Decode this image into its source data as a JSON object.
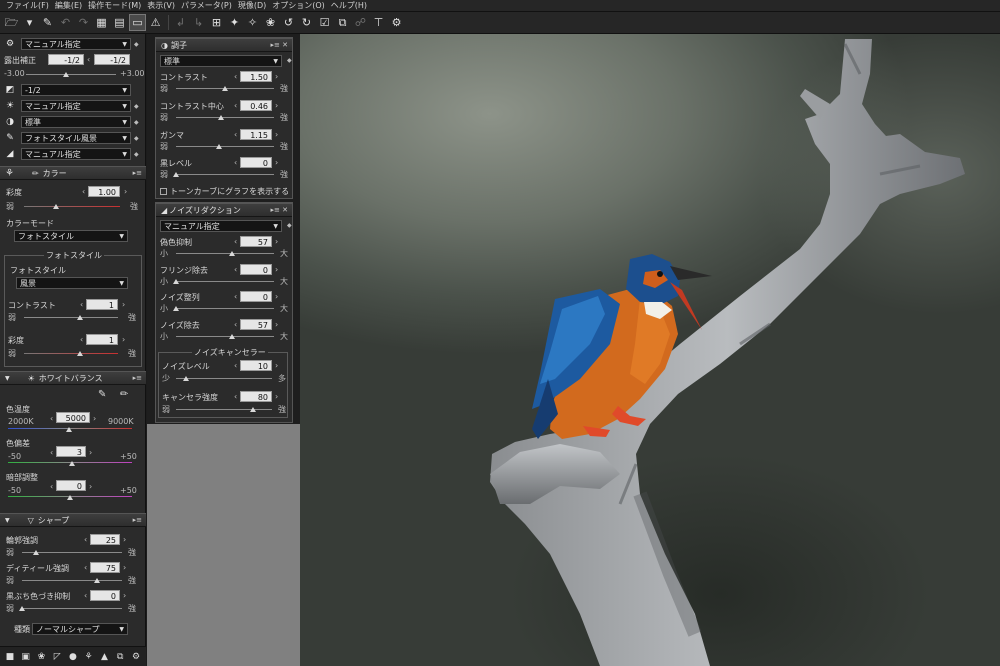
{
  "menu": [
    "ファイル(F)",
    "編集(E)",
    "操作モード(M)",
    "表示(V)",
    "パラメータ(P)",
    "現像(D)",
    "オプション(O)",
    "ヘルプ(H)"
  ],
  "toolbar_icons": [
    "open-icon",
    "open-folder-icon",
    "eyedropper-icon",
    "undo-icon",
    "redo-icon",
    "grid-view-icon",
    "filmstrip-view-icon",
    "single-view-icon",
    "warning-icon",
    "rotate-left-icon",
    "rotate-right-icon",
    "crop-icon",
    "magic-wand-icon",
    "dust-icon",
    "spot-icon",
    "tone-icon",
    "flip-icon",
    "rotate-icon",
    "check-icon",
    "compare-icon",
    "transfer-icon",
    "text-icon",
    "stamp-icon"
  ],
  "left": {
    "preset": "マニュアル指定",
    "exposure": {
      "label": "露出補正",
      "value1": "-1/2",
      "value2": "-1/2",
      "min": "-3.00",
      "max": "+3.00",
      "pos": 0.44
    },
    "rows": [
      {
        "value": "-1/2"
      },
      {
        "value": "マニュアル指定"
      },
      {
        "value": "標準"
      },
      {
        "value": "フォトスタイル風景"
      },
      {
        "value": "マニュアル指定"
      }
    ],
    "color": {
      "title": "カラー",
      "saturation": {
        "label": "彩度",
        "value": "1.00",
        "left": "弱",
        "right": "強",
        "pos": 0.33
      },
      "mode_label": "カラーモード",
      "mode_value": "フォトスタイル",
      "fieldset": "フォトスタイル",
      "style_label": "フォトスタイル",
      "style_value": "風景",
      "contrast": {
        "label": "コントラスト",
        "value": "1",
        "left": "弱",
        "right": "強",
        "pos": 0.6
      },
      "saturation2": {
        "label": "彩度",
        "value": "1",
        "left": "弱",
        "right": "強",
        "pos": 0.6
      }
    },
    "wb": {
      "title": "ホワイトバランス",
      "temp": {
        "label": "色温度",
        "value": "5000",
        "left": "2000K",
        "right": "9000K",
        "pos": 0.49
      },
      "tint": {
        "label": "色偏差",
        "value": "3",
        "left": "-50",
        "right": "+50",
        "pos": 0.52
      },
      "brightness": {
        "label": "暗部調整",
        "value": "0",
        "left": "-50",
        "right": "+50",
        "pos": 0.5
      }
    },
    "sharp": {
      "title": "シャープ",
      "edge": {
        "label": "輪郭強調",
        "value": "25",
        "left": "弱",
        "right": "強",
        "pos": 0.14
      },
      "detail": {
        "label": "ディティール強調",
        "value": "75",
        "left": "弱",
        "right": "強",
        "pos": 0.75
      },
      "fringe": {
        "label": "黒ぶち色づき抑制",
        "value": "0",
        "left": "弱",
        "right": "強",
        "pos": 0.0
      },
      "type_label": "種類",
      "type_value": "ノーマルシャープ"
    },
    "bottom_icons": [
      "comment-icon",
      "display-icon",
      "color-icon",
      "tone-curve-icon",
      "sphere-icon",
      "palette-icon",
      "lens-icon",
      "fullscreen-icon",
      "settings-icon"
    ]
  },
  "tone": {
    "title": "調子",
    "preset": "標準",
    "contrast": {
      "label": "コントラスト",
      "value": "1.50",
      "left": "弱",
      "right": "強",
      "pos": 0.5
    },
    "contrast_center": {
      "label": "コントラスト中心",
      "value": "0.46",
      "left": "弱",
      "right": "強",
      "pos": 0.46
    },
    "gamma": {
      "label": "ガンマ",
      "value": "1.15",
      "left": "弱",
      "right": "強",
      "pos": 0.44
    },
    "black": {
      "label": "黒レベル",
      "value": "0",
      "left": "弱",
      "right": "強",
      "pos": 0.0
    },
    "checkbox": "トーンカーブにグラフを表示する"
  },
  "nr": {
    "title": "ノイズリダクション",
    "preset": "マニュアル指定",
    "false_color": {
      "label": "偽色抑制",
      "value": "57",
      "left": "小",
      "right": "大",
      "pos": 0.57
    },
    "fringe": {
      "label": "フリンジ除去",
      "value": "0",
      "left": "小",
      "right": "大",
      "pos": 0.0
    },
    "noise_shape": {
      "label": "ノイズ整列",
      "value": "0",
      "left": "小",
      "right": "大",
      "pos": 0.0
    },
    "noise_remove": {
      "label": "ノイズ除去",
      "value": "57",
      "left": "小",
      "right": "大",
      "pos": 0.57
    },
    "canceller_title": "ノイズキャンセラー",
    "level": {
      "label": "ノイズレベル",
      "value": "10",
      "left": "少",
      "right": "多",
      "pos": 0.1
    },
    "strength": {
      "label": "キャンセラ強度",
      "value": "80",
      "left": "弱",
      "right": "強",
      "pos": 0.8
    }
  },
  "colors": {
    "panel": "#2b2b2b",
    "accent_red": "#c83030",
    "blue_track": "#3050d0",
    "pink_track": "#c040c0"
  }
}
